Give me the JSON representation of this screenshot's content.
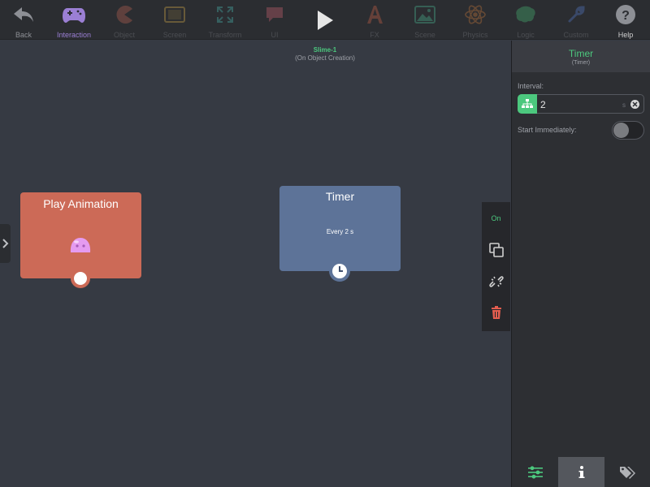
{
  "toolbar": {
    "items": [
      {
        "label": "Back",
        "icon": "back-arrow-icon"
      },
      {
        "label": "Interaction",
        "icon": "gamepad-icon"
      },
      {
        "label": "Object",
        "icon": "pacman-icon"
      },
      {
        "label": "Screen",
        "icon": "screen-icon"
      },
      {
        "label": "Transform",
        "icon": "transform-arrows-icon"
      },
      {
        "label": "UI",
        "icon": "speech-bubble-icon"
      },
      {
        "label": "",
        "icon": "play-icon"
      },
      {
        "label": "FX",
        "icon": "fx-icon"
      },
      {
        "label": "Scene",
        "icon": "landscape-image-icon"
      },
      {
        "label": "Physics",
        "icon": "atom-icon"
      },
      {
        "label": "Logic",
        "icon": "brain-icon"
      },
      {
        "label": "Custom",
        "icon": "wrench-icon"
      },
      {
        "label": "Help",
        "icon": "help-icon"
      }
    ]
  },
  "canvas": {
    "object_name": "Slime-1",
    "event_name": "(On Object Creation)",
    "nodes": {
      "play_animation": {
        "title": "Play Animation",
        "icon": "slime-icon"
      },
      "timer": {
        "title": "Timer",
        "subtitle": "Every 2 s",
        "icon": "clock-icon"
      }
    },
    "actions": {
      "on_label": "On"
    }
  },
  "panel": {
    "title": "Timer",
    "subtitle": "(Timer)",
    "interval_label": "Interval:",
    "interval_value": "2",
    "interval_unit": "s",
    "start_immediately_label": "Start Immediately:",
    "start_immediately": false
  },
  "colors": {
    "accent_green": "#4cc87e",
    "action_node": "#cc6a57",
    "trigger_node": "#5d7398",
    "delete_red": "#e35d4f"
  }
}
